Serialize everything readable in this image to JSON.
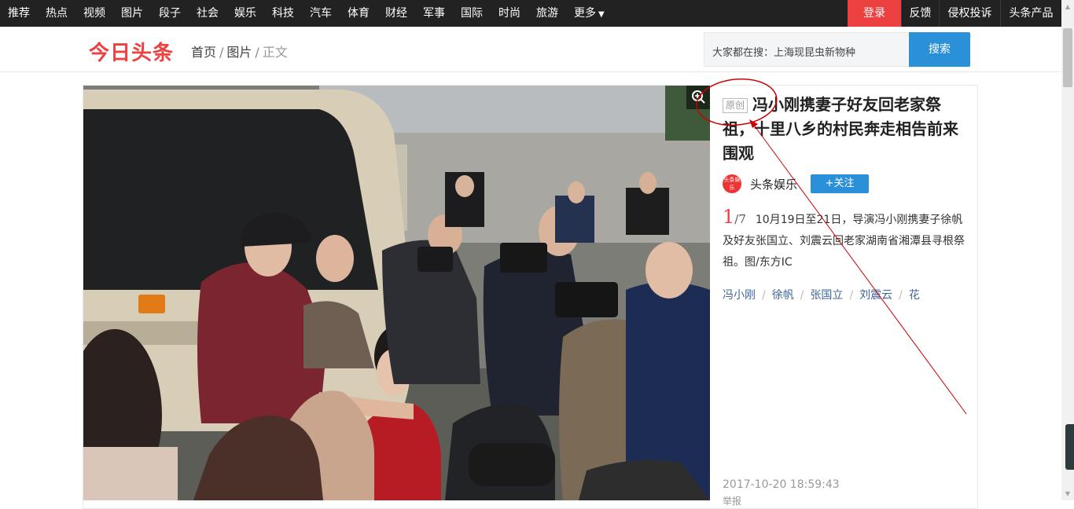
{
  "top_nav": {
    "items": [
      "推荐",
      "热点",
      "视频",
      "图片",
      "段子",
      "社会",
      "娱乐",
      "科技",
      "汽车",
      "体育",
      "财经",
      "军事",
      "国际",
      "时尚",
      "旅游",
      "更多"
    ],
    "right": [
      "登录",
      "反馈",
      "侵权投诉",
      "头条产品"
    ]
  },
  "header": {
    "logo": "今日头条",
    "breadcrumb": [
      "首页",
      "图片",
      "正文"
    ],
    "search_placeholder": "大家都在搜：上海现昆虫新物种",
    "search_button": "搜索"
  },
  "article": {
    "original_tag": "原创",
    "title": "冯小刚携妻子好友回老家祭祖，十里八乡的村民奔走相告前来围观",
    "author": "头条娱乐",
    "author_avatar_text": "头条娱乐",
    "follow_label": "+关注",
    "page_current": "1",
    "page_total": "/7",
    "description": "10月19日至21日，导演冯小刚携妻子徐帆及好友张国立、刘震云回老家湖南省湘潭县寻根祭祖。图/东方IC",
    "tags": [
      "冯小刚",
      "徐帆",
      "张国立",
      "刘震云",
      "花"
    ],
    "date": "2017-10-20 18:59:43",
    "report": "举报"
  },
  "colors": {
    "brand_red": "#ed4040",
    "nav_bg": "#222222",
    "button_blue": "#2a90d7",
    "tag_link": "#406599",
    "annotation_red": "#cc0000"
  }
}
